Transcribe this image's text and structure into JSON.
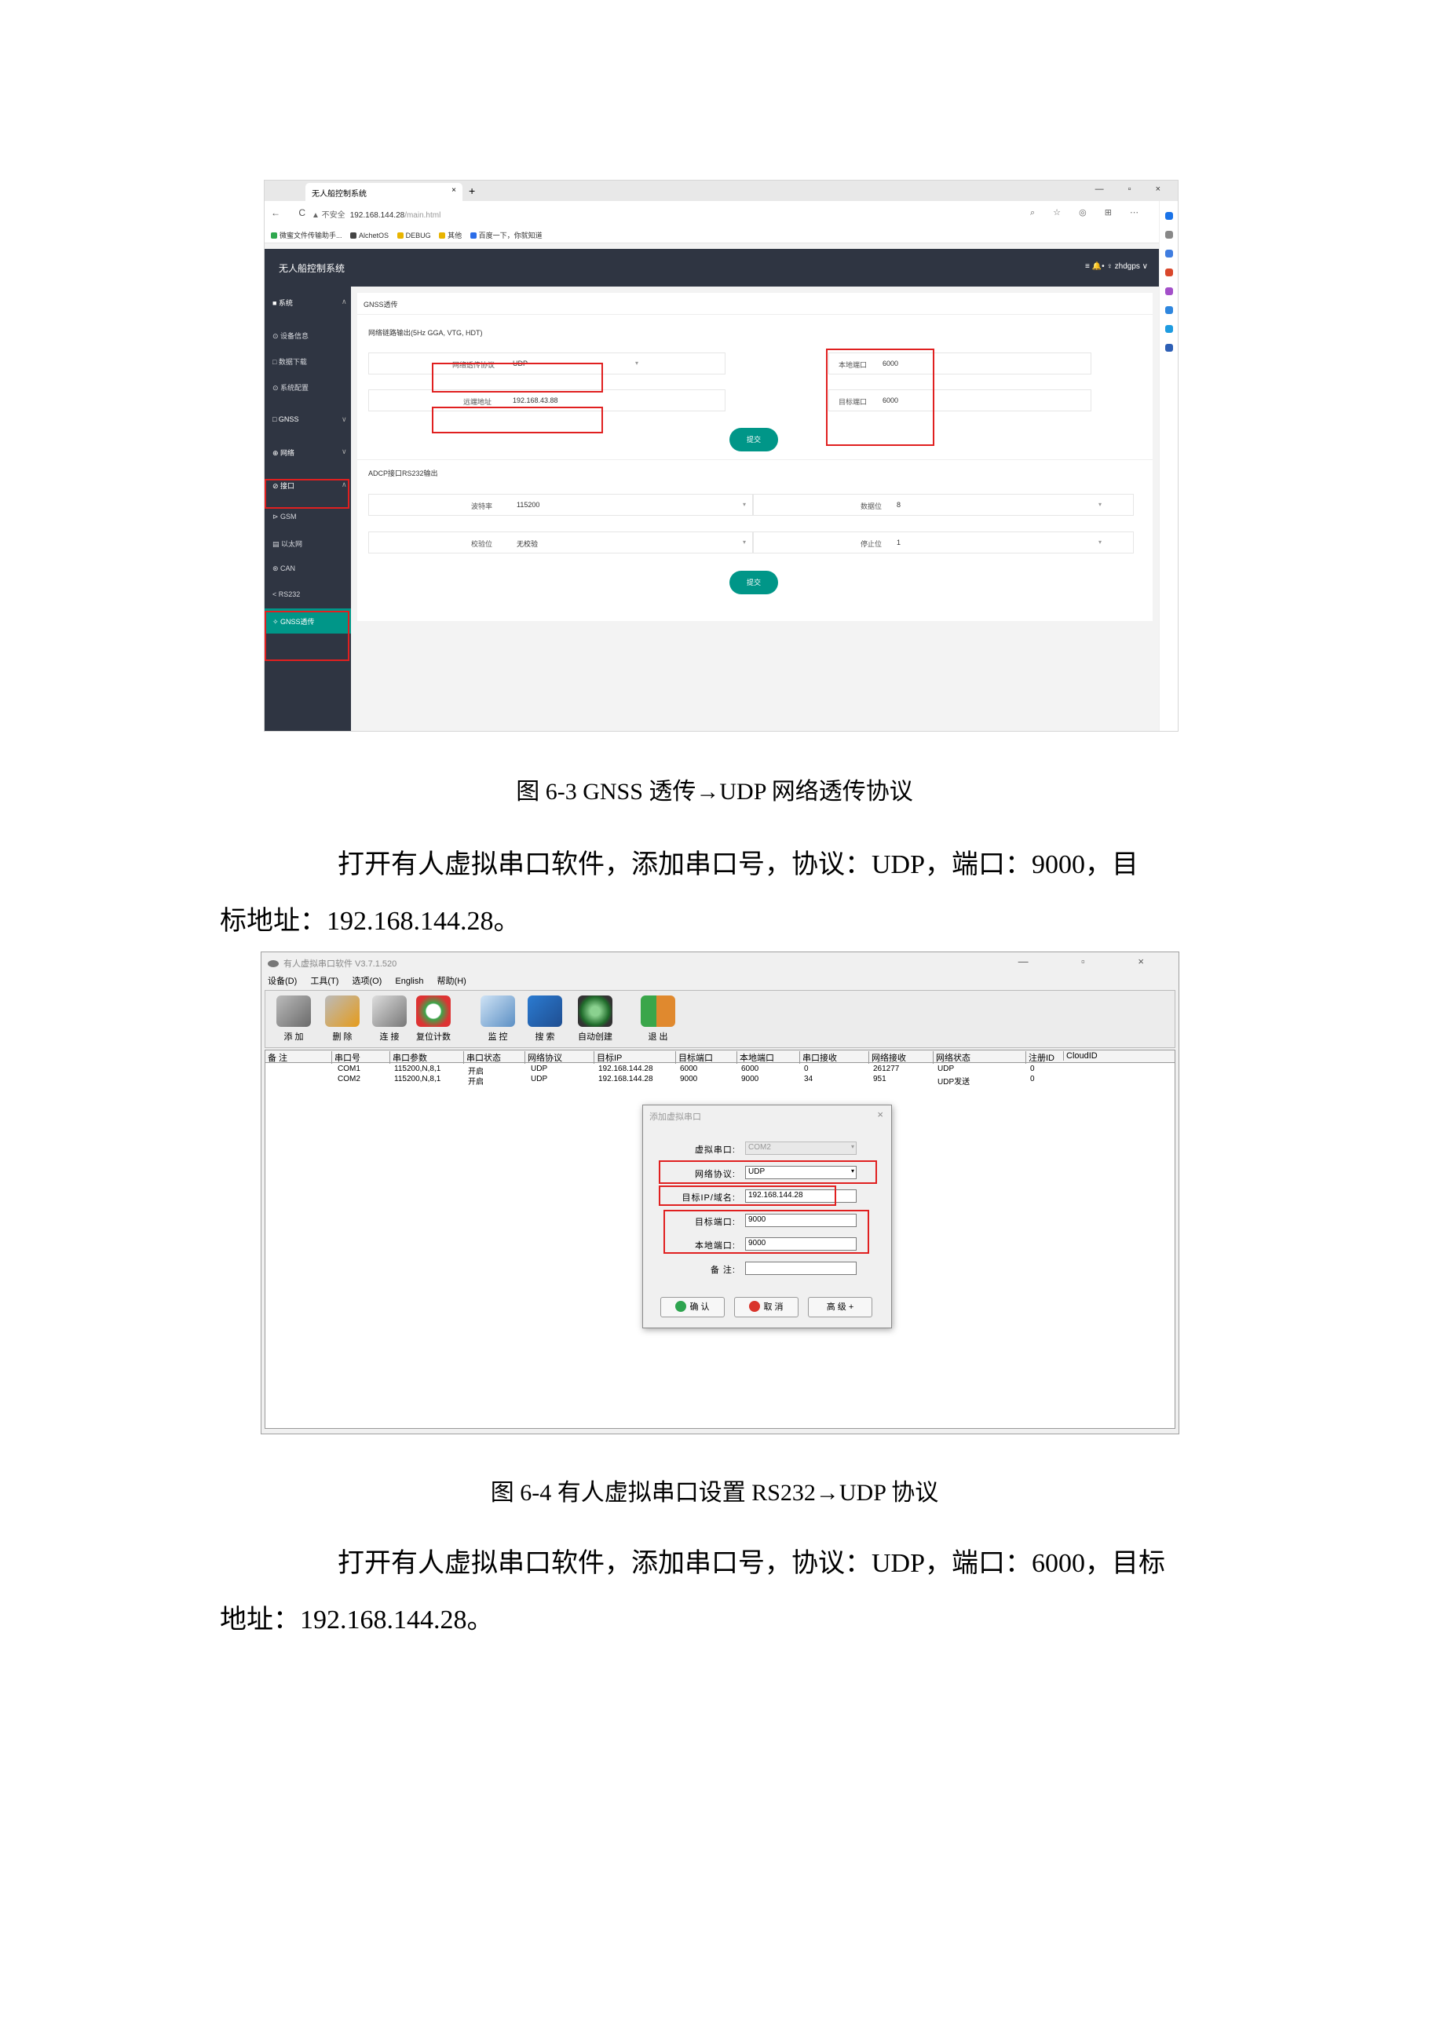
{
  "figure1": {
    "tab_title": "无人船控制系统",
    "tab_close": "×",
    "new_tab": "+",
    "window_controls": "— ▫ ×",
    "nav": "← C",
    "url_tag": "▲ 不安全",
    "url": "192.168.144.28",
    "url_path": "/main.html",
    "toolbar_icons": "⌕ ☆ ◎ ⊞ ⋯",
    "bookmarks": [
      "微蜜文件传输助手...",
      "AlchetOS",
      "DEBUG",
      "其他",
      "百度一下，你就知道"
    ],
    "app_title": "无人船控制系统",
    "user": "≡   🔔•   ♀ zhdgps ∨",
    "sidebar": {
      "system": "■ 系统",
      "device_info": "⊙ 设备信息",
      "data_download": "□ 数据下载",
      "system_config": "⊙ 系统配置",
      "gnss": "□ GNSS",
      "network": "⊕ 网络",
      "serial": "⊘ 接口",
      "gsm": "⊳ GSM",
      "ethernet": "▤ 以太网",
      "can": "⊛ CAN",
      "rs232": "< RS232",
      "gnss_passthrough": "✧ GNSS透传"
    },
    "chevron_up": "∧",
    "chevron_down": "∨",
    "panel_title": "GNSS透传",
    "network_section": "网络链路输出(5Hz GGA, VTG, HDT)",
    "protocol_label": "网络透传协议",
    "protocol_value": "UDP",
    "remote_addr_label": "远端地址",
    "remote_addr_value": "192.168.43.88",
    "local_port_label": "本地端口",
    "local_port_value": "6000",
    "target_port_label": "目标端口",
    "target_port_value": "6000",
    "submit": "提交",
    "serial_section": "ADCP接口RS232输出",
    "baud_label": "波特率",
    "baud_value": "115200",
    "databits_label": "数据位",
    "databits_value": "8",
    "parity_label": "校验位",
    "parity_value": "无校验",
    "stopbits_label": "停止位",
    "stopbits_value": "1",
    "dropdown_arrow": "▾"
  },
  "caption1": "图 6-3 GNSS 透传→UDP 网络透传协议",
  "para1_line1": "打开有人虚拟串口软件，添加串口号，协议：UDP，端口：9000，目",
  "para1_line2": "标地址：192.168.144.28。",
  "figure2": {
    "title": "有人虚拟串口软件 V3.7.1.520",
    "window_controls": "— ▫ ×",
    "menu": [
      "设备(D)",
      "工具(T)",
      "选项(O)",
      "English",
      "帮助(H)"
    ],
    "toolbar": [
      "添 加",
      "删 除",
      "连 接",
      "复位计数",
      "监 控",
      "搜 索",
      "自动创建",
      "退 出"
    ],
    "columns": [
      "备 注",
      "串口号",
      "串口参数",
      "串口状态",
      "网络协议",
      "目标IP",
      "目标端口",
      "本地端口",
      "串口接收",
      "网络接收",
      "网络状态",
      "注册ID",
      "CloudID"
    ],
    "rows": [
      [
        "",
        "COM1",
        "115200,N,8,1",
        "开启",
        "UDP",
        "192.168.144.28",
        "6000",
        "6000",
        "0",
        "261277",
        "UDP",
        "0",
        ""
      ],
      [
        "",
        "COM2",
        "115200,N,8,1",
        "开启",
        "UDP",
        "192.168.144.28",
        "9000",
        "9000",
        "34",
        "951",
        "UDP发送",
        "0",
        ""
      ]
    ],
    "dialog": {
      "title": "添加虚拟串口",
      "close": "×",
      "virtual_port_label": "虚拟串口:",
      "virtual_port_value": "COM2",
      "protocol_label": "网络协议:",
      "protocol_value": "UDP",
      "target_ip_label": "目标IP/域名:",
      "target_ip_value": "192.168.144.28",
      "target_port_label": "目标端口:",
      "target_port_value": "9000",
      "local_port_label": "本地端口:",
      "local_port_value": "9000",
      "remark_label": "备 注:",
      "remark_value": "",
      "ok": "确 认",
      "cancel": "取 消",
      "advanced": "高 级 +",
      "dropdown_arrow": "▾"
    }
  },
  "caption2": "图 6-4  有人虚拟串口设置 RS232→UDP 协议",
  "para2_line1": "打开有人虚拟串口软件，添加串口号，协议：UDP，端口：6000，目标",
  "para2_line2": "地址：192.168.144.28。",
  "colors": {
    "accent": "#009688",
    "header_bg": "#2f3542",
    "highlight_box": "#e02020"
  }
}
